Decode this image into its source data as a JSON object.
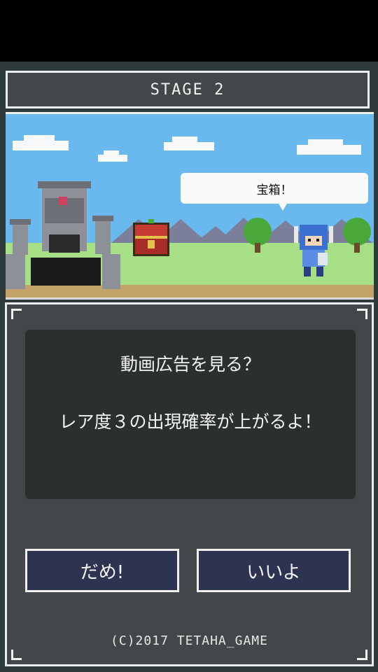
{
  "stage": {
    "title": "STAGE 2"
  },
  "scene": {
    "speech_bubble": "宝箱！",
    "sky_color": "#69b8ee",
    "grass_color": "#a7df86",
    "mountain_color": "#7b7f9a"
  },
  "dialog": {
    "question": "動画広告を見る？",
    "detail": "レア度３の出現確率が上がるよ！",
    "no_label": "だめ!",
    "yes_label": "いいよ"
  },
  "footer": {
    "copyright": "(C)2017 TETAHA_GAME"
  },
  "colors": {
    "panel": "#42484a",
    "message_box": "#2a2f30",
    "button": "#2d3350",
    "border": "#f0f0f0"
  }
}
